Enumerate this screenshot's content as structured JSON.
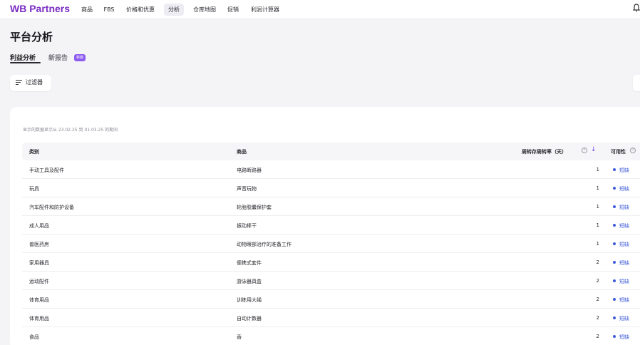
{
  "brand": {
    "logo": "WB Partners",
    "color": "#7a2cc4"
  },
  "nav": {
    "items": [
      {
        "label": "商品",
        "active": false
      },
      {
        "label": "FBS",
        "active": false
      },
      {
        "label": "价格和优惠",
        "active": false
      },
      {
        "label": "分析",
        "active": true
      },
      {
        "label": "仓库地图",
        "active": false
      },
      {
        "label": "促销",
        "active": false
      },
      {
        "label": "利润计算器",
        "active": false
      }
    ],
    "bell_icon": "bell-icon"
  },
  "page": {
    "title": "平台分析",
    "tabs": [
      {
        "label": "利益分析",
        "active": true
      },
      {
        "label": "新报告",
        "active": false
      }
    ],
    "new_badge": "新版",
    "filter_button": "过滤器",
    "filter_icon": "filter-icon"
  },
  "table": {
    "period_note": "显示的数据显示从 23.02.25 到 01.03.25 的期间",
    "headers": {
      "category": "类别",
      "product": "商品",
      "days": "周转存周转率（天）",
      "availability": "可用性"
    },
    "sort_icon": "arrow-down-icon",
    "help_icon": "question-circle-icon",
    "status_color": "#3d5bd9",
    "rows": [
      {
        "category": "手动工具及配件",
        "product": "电路断路器",
        "days": "1",
        "availability": "短缺"
      },
      {
        "category": "玩具",
        "product": "声音玩物",
        "days": "1",
        "availability": "短缺"
      },
      {
        "category": "汽车配件和防护设备",
        "product": "轮胎胶囊保护套",
        "days": "1",
        "availability": "短缺"
      },
      {
        "category": "成人用品",
        "product": "振动棒干",
        "days": "1",
        "availability": "短缺"
      },
      {
        "category": "兽医药房",
        "product": "动物眼部治疗的准备工作",
        "days": "1",
        "availability": "短缺"
      },
      {
        "category": "家用器具",
        "product": "便携式套件",
        "days": "2",
        "availability": "短缺"
      },
      {
        "category": "运动配件",
        "product": "游泳器具盒",
        "days": "2",
        "availability": "短缺"
      },
      {
        "category": "体育用品",
        "product": "训练用大绳",
        "days": "2",
        "availability": "短缺"
      },
      {
        "category": "体育用品",
        "product": "自动计数器",
        "days": "2",
        "availability": "短缺"
      },
      {
        "category": "食品",
        "product": "香",
        "days": "2",
        "availability": "短缺"
      }
    ]
  }
}
